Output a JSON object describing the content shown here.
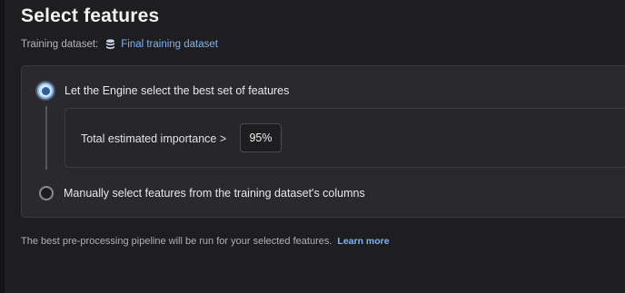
{
  "header": {
    "title": "Select features"
  },
  "dataset": {
    "label": "Training dataset:",
    "icon": "database-icon",
    "name": "Final training dataset"
  },
  "options": {
    "engine": {
      "label": "Let the Engine select the best set of features",
      "selected": true
    },
    "importance": {
      "label": "Total estimated importance >",
      "value": "95%"
    },
    "manual": {
      "label": "Manually select features from the training dataset's columns",
      "selected": false
    }
  },
  "footer": {
    "text": "The best pre-processing pipeline will be run for your selected features.",
    "link": "Learn more"
  },
  "colors": {
    "accent": "#7db3f0",
    "background": "#1e1e21",
    "card": "#2a2a2e"
  }
}
